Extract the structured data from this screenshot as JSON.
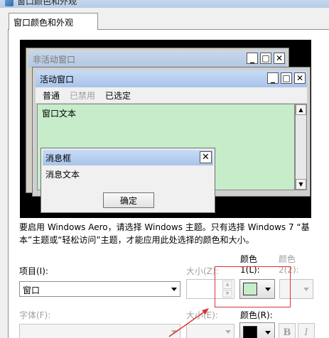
{
  "window": {
    "title": "窗口颜色和外观"
  },
  "tabs": [
    {
      "label": "窗口颜色和外观"
    }
  ],
  "preview": {
    "inactive_window": {
      "title": "非活动窗口"
    },
    "active_window": {
      "title": "活动窗口",
      "menu": {
        "normal": "普通",
        "disabled": "已禁用",
        "selected": "已选定"
      },
      "text": "窗口文本"
    },
    "message_box": {
      "title": "消息框",
      "text": "消息文本",
      "ok": "确定"
    },
    "caption_buttons": {
      "minimize": "_",
      "maximize": "□",
      "close": "✕"
    }
  },
  "description": "要启用 Windows Aero，请选择 Windows 主题。只有选择 Windows 7 “基本”主题或“轻松访问”主题，才能应用此处选择的颜色和大小。",
  "form": {
    "item_label": "项目(I):",
    "item_value": "窗口",
    "size_label": "大小(Z):",
    "color1_label_top": "颜色",
    "color1_label_bottom": "1(L):",
    "color2_label_top": "颜色",
    "color2_label_bottom": "2(2):",
    "font_label": "字体(F):",
    "font_size_label": "大小(E):",
    "font_color_label": "颜色(R):",
    "bold": "B",
    "italic": "I"
  },
  "colors": {
    "window_color": "#c6ecc9",
    "font_color": "#000000",
    "annotation": "#e03030"
  }
}
